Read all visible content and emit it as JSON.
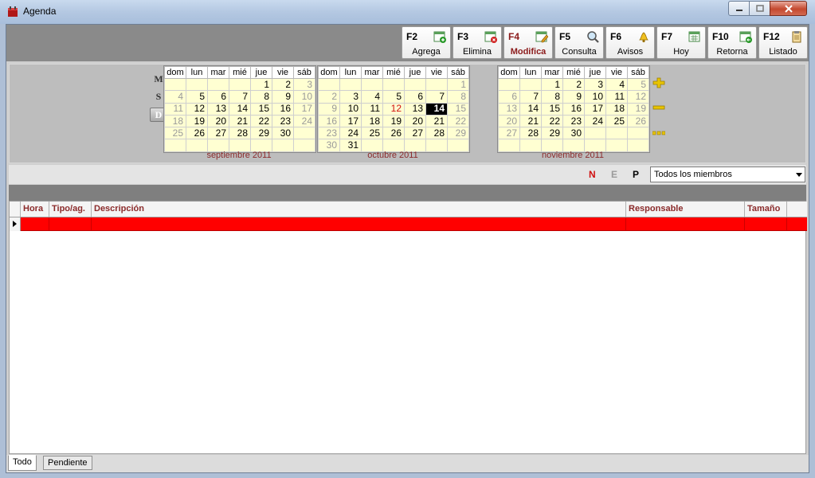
{
  "window": {
    "title": "Agenda"
  },
  "toolbar": {
    "buttons": [
      {
        "key": "F2",
        "label": "Agrega"
      },
      {
        "key": "F3",
        "label": "Elimina"
      },
      {
        "key": "F4",
        "label": "Modifica"
      },
      {
        "key": "F5",
        "label": "Consulta"
      },
      {
        "key": "F6",
        "label": "Avisos"
      },
      {
        "key": "F7",
        "label": "Hoy"
      },
      {
        "key": "F10",
        "label": "Retorna"
      },
      {
        "key": "F12",
        "label": "Listado"
      }
    ]
  },
  "view_modes": [
    "M",
    "S",
    "D"
  ],
  "calendar": {
    "day_headers": [
      "dom",
      "lun",
      "mar",
      "mié",
      "jue",
      "vie",
      "sáb"
    ],
    "months": [
      {
        "name": "septiembre 2011",
        "weeks": [
          [
            "",
            "",
            "",
            "",
            "1",
            "2",
            "3"
          ],
          [
            "4",
            "5",
            "6",
            "7",
            "8",
            "9",
            "10"
          ],
          [
            "11",
            "12",
            "13",
            "14",
            "15",
            "16",
            "17"
          ],
          [
            "18",
            "19",
            "20",
            "21",
            "22",
            "23",
            "24"
          ],
          [
            "25",
            "26",
            "27",
            "28",
            "29",
            "30",
            ""
          ],
          [
            "",
            "",
            "",
            "",
            "",
            "",
            ""
          ]
        ]
      },
      {
        "name": "octubre 2011",
        "weeks": [
          [
            "",
            "",
            "",
            "",
            "",
            "",
            "1"
          ],
          [
            "2",
            "3",
            "4",
            "5",
            "6",
            "7",
            "8"
          ],
          [
            "9",
            "10",
            "11",
            "12",
            "13",
            "14",
            "15"
          ],
          [
            "16",
            "17",
            "18",
            "19",
            "20",
            "21",
            "22"
          ],
          [
            "23",
            "24",
            "25",
            "26",
            "27",
            "28",
            "29"
          ],
          [
            "30",
            "31",
            "",
            "",
            "",
            "",
            ""
          ]
        ]
      },
      {
        "name": "noviembre 2011",
        "weeks": [
          [
            "",
            "",
            "1",
            "2",
            "3",
            "4",
            "5"
          ],
          [
            "6",
            "7",
            "8",
            "9",
            "10",
            "11",
            "12"
          ],
          [
            "13",
            "14",
            "15",
            "16",
            "17",
            "18",
            "19"
          ],
          [
            "20",
            "21",
            "22",
            "23",
            "24",
            "25",
            "26"
          ],
          [
            "27",
            "28",
            "29",
            "30",
            "",
            "",
            ""
          ],
          [
            "",
            "",
            "",
            "",
            "",
            "",
            ""
          ]
        ]
      }
    ]
  },
  "filter": {
    "n": "N",
    "e": "E",
    "p": "P",
    "member_select": "Todos los miembros"
  },
  "grid": {
    "columns": [
      "Hora",
      "Tipo/ag.",
      "Descripción",
      "Responsable",
      "Tamaño"
    ]
  },
  "tabs": [
    "Todo",
    "Pendiente"
  ]
}
